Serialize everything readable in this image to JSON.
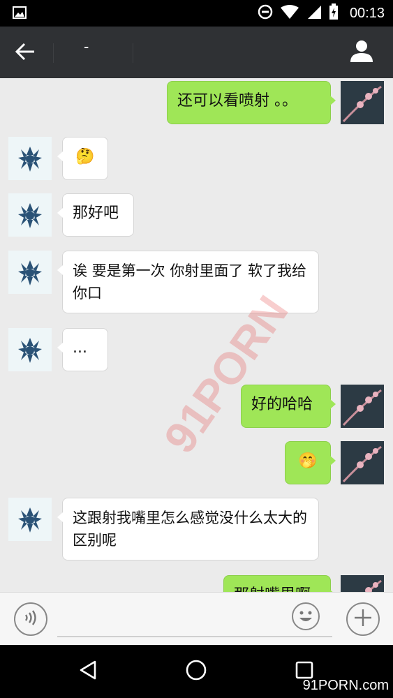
{
  "status_bar": {
    "time": "00:13",
    "icons": [
      "image-icon",
      "do-not-disturb-icon",
      "wifi-icon",
      "signal-icon",
      "battery-charging-icon"
    ]
  },
  "header": {
    "title": "-",
    "back_icon": "back-arrow-icon",
    "profile_icon": "person-icon"
  },
  "messages": [
    {
      "side": "out",
      "text": "还可以看喷射 。。"
    },
    {
      "side": "in",
      "text": "🤔"
    },
    {
      "side": "in",
      "text": "那好吧"
    },
    {
      "side": "in",
      "text": "诶 要是第一次 你射里面了 软了我给你口"
    },
    {
      "side": "in",
      "text": "..."
    },
    {
      "side": "out",
      "text": "好的哈哈"
    },
    {
      "side": "out",
      "text": "🤭"
    },
    {
      "side": "in",
      "text": "这跟射我嘴里怎么感觉没什么太大的区别呢"
    },
    {
      "side": "out",
      "text": "那射嘴里啊"
    }
  ],
  "input_bar": {
    "placeholder": "",
    "voice_icon": "voice-icon",
    "emoji_icon": "emoji-icon",
    "plus_icon": "plus-icon"
  },
  "nav_bar": {
    "icons": [
      "back-triangle-icon",
      "home-circle-icon",
      "recents-square-icon"
    ]
  },
  "watermark": {
    "large": "91PORN",
    "small": "91PORN.com",
    "color": "#e65050"
  },
  "colors": {
    "outgoing_bubble": "#9fe657",
    "incoming_bubble": "#ffffff",
    "header_bg": "#2f3134",
    "chat_bg": "#ebebeb"
  }
}
